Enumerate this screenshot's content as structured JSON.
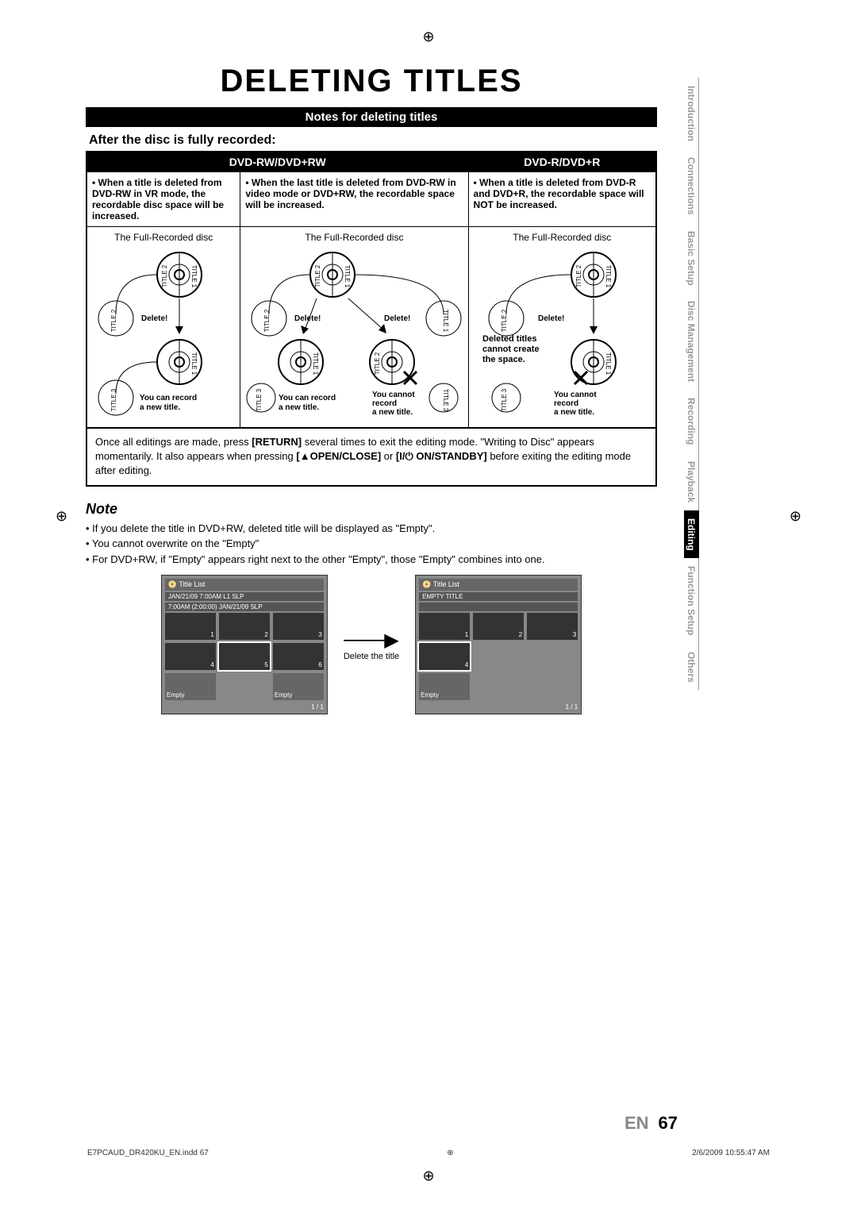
{
  "reg_marks": "⊕",
  "title": "DELETING TITLES",
  "notes_bar": "Notes for deleting titles",
  "after": "After the disc is fully recorded:",
  "headers": {
    "rw": "DVD-RW/DVD+RW",
    "r": "DVD-R/DVD+R"
  },
  "col1_note": "• When a title is deleted from DVD-RW in VR mode, the recordable disc space will be increased.",
  "col2_note": "• When the last title is deleted from DVD-RW in video mode or DVD+RW, the recordable space will be increased.",
  "col3_note": "• When a title is deleted from DVD-R and DVD+R, the recordable space will NOT be increased.",
  "full_label": "The Full-Recorded disc",
  "delete_label": "Delete!",
  "deleted_cannot": "Deleted titles cannot create the space.",
  "you_can": "You can record a new title.",
  "you_cannot": "You cannot record a new title.",
  "title1": "TITLE 1",
  "title2": "TITLE 2",
  "title3": "TITLE 3",
  "below_table": "Once all editings are made, press [RETURN] several times to exit the editing mode. \"Writing to Disc\" appears momentarily. It also appears when pressing [▲OPEN/CLOSE] or [I/⏻ ON/STANDBY] before exiting the editing mode after editing.",
  "note_heading": "Note",
  "note1": "• If you delete the title in DVD+RW, deleted title will be displayed as \"Empty\".",
  "note2": "• You cannot overwrite on the \"Empty\"",
  "note3": "• For DVD+RW, if \"Empty\" appears right next to the other \"Empty\", those \"Empty\" combines into one.",
  "tl_header": "Title List",
  "tl_sub1": "JAN/21/09  7:00AM  L1  SLP",
  "tl_sub2": "7:00AM (2:00:00)     JAN/21/09        SLP",
  "tl_empty_title": "EMPTY TITLE",
  "tl_empty": "Empty",
  "tl_page": "1 / 1",
  "arrow_label": "Delete the title",
  "tabs": [
    "Introduction",
    "Connections",
    "Basic Setup",
    "Disc Management",
    "Recording",
    "Playback",
    "Editing",
    "Function Setup",
    "Others"
  ],
  "page_en": "EN",
  "page_no": "67",
  "footer_left": "E7PCAUD_DR420KU_EN.indd   67",
  "footer_right": "2/6/2009   10:55:47 AM"
}
